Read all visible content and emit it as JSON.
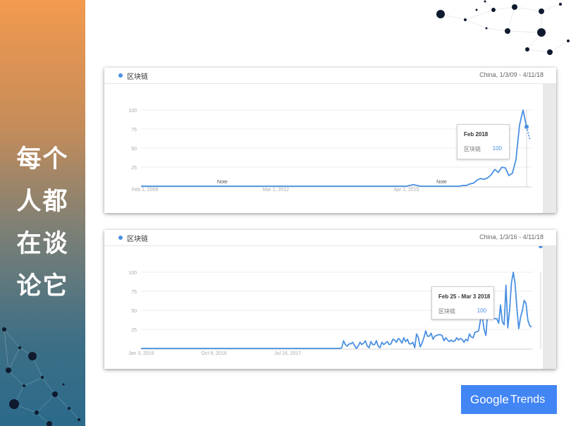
{
  "side_title": [
    "每个",
    "人都",
    "在谈",
    "论它"
  ],
  "logo": {
    "google": "Google",
    "trends": "Trends"
  },
  "colors": {
    "series": "#4a90e2",
    "panel_top": "#f39a4e",
    "panel_bottom": "#2b6a8b",
    "logo_bg": "#4285f4"
  },
  "charts": [
    {
      "legend": "区块链",
      "range": "China, 1/3/09 - 4/11/18",
      "tooltip": {
        "title": "Feb 2018",
        "term": "区块链",
        "value": "100"
      }
    },
    {
      "legend": "区块链",
      "range": "China, 1/3/16 - 4/11/18",
      "tooltip": {
        "title": "Feb 25 - Mar 3 2018",
        "term": "区块链",
        "value": "100"
      }
    }
  ],
  "chart_data": [
    {
      "type": "line",
      "title": "",
      "series": [
        {
          "name": "区块链",
          "values": [
            0,
            0,
            0,
            0,
            0,
            0,
            0,
            0,
            0,
            0,
            0,
            0,
            0,
            0,
            0,
            0,
            0,
            0,
            0,
            0,
            0,
            0,
            0,
            0,
            0,
            0,
            0,
            0,
            0,
            0,
            0,
            0,
            0,
            0,
            0,
            0,
            0,
            0,
            0,
            0,
            0,
            0,
            0,
            0,
            0,
            0,
            0,
            0,
            0,
            0,
            0,
            0,
            0,
            0,
            0,
            0,
            0,
            0,
            0,
            0,
            0,
            0,
            0,
            0,
            0,
            0,
            0,
            0,
            0,
            0,
            0,
            0,
            0,
            0,
            0,
            0,
            1,
            2,
            1,
            0,
            0,
            0,
            0,
            0,
            0,
            0,
            0,
            0,
            0,
            0,
            0,
            1,
            1,
            3,
            4,
            8,
            10,
            9,
            11,
            15,
            22,
            18,
            25,
            24,
            14,
            17,
            35,
            80,
            100,
            78,
            60
          ]
        }
      ],
      "x_ticks": [
        "Feb 1, 2009",
        "Mar 1, 2012",
        "Apr 1, 2015"
      ],
      "x_tick_index": [
        1,
        38,
        75
      ],
      "y_ticks": [
        25,
        50,
        75,
        100
      ],
      "ylim": [
        0,
        100
      ],
      "highlight_index": 109,
      "dashed_from_index": 109,
      "notes": [
        {
          "label": "Note",
          "index": 23
        },
        {
          "label": "Note",
          "index": 85
        }
      ],
      "grid": true
    },
    {
      "type": "line",
      "title": "",
      "series": [
        {
          "name": "区块链",
          "values": [
            0,
            0,
            0,
            0,
            0,
            0,
            0,
            0,
            0,
            0,
            0,
            0,
            0,
            0,
            0,
            0,
            0,
            0,
            0,
            0,
            0,
            0,
            0,
            0,
            0,
            0,
            0,
            0,
            0,
            0,
            0,
            0,
            0,
            0,
            0,
            0,
            0,
            0,
            0,
            0,
            0,
            0,
            0,
            0,
            0,
            0,
            0,
            0,
            0,
            0,
            0,
            0,
            0,
            0,
            0,
            0,
            0,
            0,
            0,
            0,
            0,
            0,
            0,
            0,
            0,
            0,
            0,
            0,
            0,
            0,
            0,
            0,
            0,
            0,
            0,
            0,
            0,
            0,
            0,
            0,
            0,
            0,
            0,
            0,
            0,
            0,
            0,
            0,
            0,
            0,
            0,
            0,
            0,
            0,
            0,
            0,
            0,
            0,
            0,
            0,
            0,
            0,
            0,
            0,
            0,
            0,
            0,
            0,
            0,
            0,
            1,
            10,
            5,
            3,
            6,
            6,
            8,
            4,
            0,
            3,
            8,
            5,
            7,
            10,
            3,
            1,
            9,
            5,
            5,
            10,
            3,
            1,
            8,
            5,
            7,
            9,
            5,
            6,
            12,
            11,
            8,
            13,
            11,
            7,
            14,
            9,
            12,
            6,
            6,
            8,
            1,
            19,
            14,
            2,
            7,
            14,
            23,
            16,
            16,
            20,
            12,
            16,
            17,
            18,
            18,
            17,
            10,
            14,
            11,
            9,
            11,
            9,
            10,
            14,
            11,
            13,
            12,
            8,
            12,
            10,
            19,
            15,
            14,
            21,
            22,
            23,
            37,
            43,
            25,
            17,
            49,
            52,
            40,
            40,
            39,
            39,
            33,
            57,
            35,
            31,
            83,
            27,
            51,
            86,
            100,
            85,
            52,
            26,
            41,
            50,
            63,
            59,
            37,
            30,
            28
          ]
        }
      ],
      "x_ticks": [
        "Jan 3, 2016",
        "Oct 9, 2016",
        "Jul 16, 2017"
      ],
      "x_tick_index": [
        0,
        40,
        80
      ],
      "y_ticks": [
        25,
        50,
        75,
        100
      ],
      "ylim": [
        0,
        100
      ],
      "highlight_index": 219,
      "grid": true
    }
  ]
}
